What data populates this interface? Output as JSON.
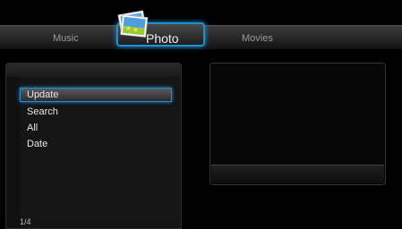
{
  "tabs": {
    "music_label": "Music",
    "photo_label": "Photo",
    "movies_label": "Movies"
  },
  "menu": {
    "items": [
      "Update",
      "Search",
      "All",
      "Date"
    ],
    "selected": "Update"
  },
  "pagination": "1/4",
  "colors": {
    "accent": "#1e8fd6",
    "background": "#000000"
  },
  "icons": [
    "photo-icon"
  ]
}
